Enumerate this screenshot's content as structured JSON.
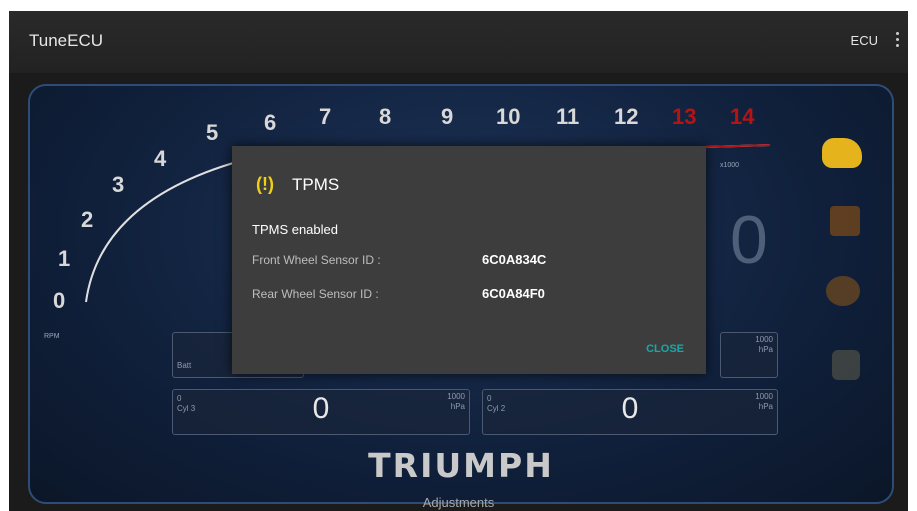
{
  "app": {
    "title": "TuneECU",
    "ecu_label": "ECU"
  },
  "gauge": {
    "rpm_numbers": [
      "0",
      "1",
      "2",
      "3",
      "4",
      "5",
      "6",
      "7",
      "8",
      "9",
      "10",
      "11",
      "12",
      "13",
      "14"
    ],
    "redline_numbers": [
      "13",
      "14"
    ],
    "unit": "RPM",
    "multiplier": "x1000",
    "big_value": "0"
  },
  "cards": [
    {
      "top_left": "Batt",
      "top_right_1": "",
      "top_right_2": "",
      "value": ""
    },
    {
      "top_left": "",
      "top_right_1": "1000",
      "top_right_2": "hPa",
      "value": ""
    },
    {
      "top_left": "0",
      "top_left_2": "Cyl 3",
      "top_right_1": "1000",
      "top_right_2": "hPa",
      "value": "0"
    },
    {
      "top_left": "0",
      "top_left_2": "Cyl 2",
      "top_right_1": "1000",
      "top_right_2": "hPa",
      "value": "0"
    }
  ],
  "brand": "TRIUMPH",
  "footer": {
    "adjustments": "Adjustments"
  },
  "dialog": {
    "warning_symbol": "(!)",
    "title": "TPMS",
    "status": "TPMS enabled",
    "front_label": "Front Wheel Sensor ID :",
    "front_value": "6C0A834C",
    "rear_label": "Rear Wheel Sensor ID :",
    "rear_value": "6C0A84F0",
    "close": "CLOSE"
  },
  "colors": {
    "warning": "#f0d010",
    "accent": "#19a7a7",
    "redline": "#b51414",
    "dash_border": "#2e4c78"
  }
}
